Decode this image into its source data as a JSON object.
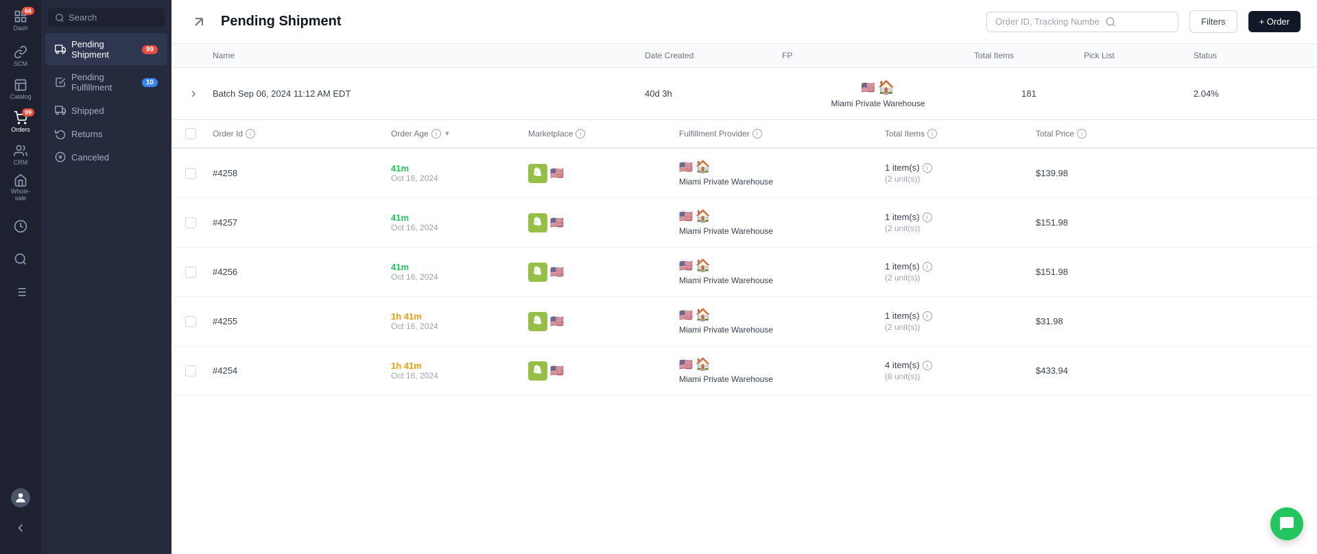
{
  "sidebar": {
    "notifications_badge": "66",
    "orders_badge": "99",
    "items": [
      {
        "id": "dash",
        "label": "Dash",
        "icon": "chart"
      },
      {
        "id": "scm",
        "label": "SCM",
        "icon": "link"
      },
      {
        "id": "catalog",
        "label": "Catalog",
        "icon": "catalog"
      },
      {
        "id": "orders",
        "label": "Orders",
        "icon": "cart",
        "badge": "99",
        "active": true
      },
      {
        "id": "crm",
        "label": "CRM",
        "icon": "users"
      },
      {
        "id": "wholesale",
        "label": "Whole-sale",
        "icon": "store"
      },
      {
        "id": "analytics",
        "label": "",
        "icon": "analytics"
      },
      {
        "id": "search",
        "label": "",
        "icon": "search"
      },
      {
        "id": "reports",
        "label": "",
        "icon": "reports"
      }
    ]
  },
  "nav": {
    "search_placeholder": "Search",
    "items": [
      {
        "id": "pending-shipment",
        "label": "Pending Shipment",
        "badge": "99",
        "badge_color": "red",
        "active": true
      },
      {
        "id": "pending-fulfillment",
        "label": "Pending Fulfillment",
        "badge": "10",
        "badge_color": "blue"
      },
      {
        "id": "shipped",
        "label": "Shipped",
        "badge": null
      },
      {
        "id": "returns",
        "label": "Returns",
        "badge": null
      },
      {
        "id": "canceled",
        "label": "Canceled",
        "badge": null
      }
    ]
  },
  "header": {
    "title": "Pending Shipment",
    "search_placeholder": "Order ID, Tracking Numbe",
    "filters_label": "Filters",
    "add_order_label": "+ Order"
  },
  "batch_table": {
    "columns": [
      "",
      "Name",
      "Date Created",
      "FP",
      "Total Items",
      "Pick List",
      "Status"
    ],
    "row": {
      "name": "Batch Sep 06, 2024 11:12 AM EDT",
      "age": "40d 3h",
      "fp_flag": "🇺🇸",
      "fp_warehouse": "🏠",
      "fp_name": "Miami Private Warehouse",
      "total_items": "181",
      "pick_list": "",
      "status": "2.04%"
    }
  },
  "orders_table": {
    "columns": {
      "order_id": "Order Id",
      "order_age": "Order Age",
      "marketplace": "Marketplace",
      "fulfillment_provider": "Fulfillment Provider",
      "total_items": "Total Items",
      "total_price": "Total Price"
    },
    "rows": [
      {
        "id": "#4258",
        "age": "41m",
        "age_color": "green",
        "date": "Oct 16, 2024",
        "marketplace": "shopify+flag",
        "fp_name": "Miami Private Warehouse",
        "items_count": "1 item(s)",
        "units": "(2 unit(s))",
        "price": "$139.98"
      },
      {
        "id": "#4257",
        "age": "41m",
        "age_color": "green",
        "date": "Oct 16, 2024",
        "marketplace": "shopify+flag",
        "fp_name": "Miami Private Warehouse",
        "items_count": "1 item(s)",
        "units": "(2 unit(s))",
        "price": "$151.98"
      },
      {
        "id": "#4256",
        "age": "41m",
        "age_color": "green",
        "date": "Oct 16, 2024",
        "marketplace": "shopify+flag",
        "fp_name": "Miami Private Warehouse",
        "items_count": "1 item(s)",
        "units": "(2 unit(s))",
        "price": "$151.98"
      },
      {
        "id": "#4255",
        "age": "1h 41m",
        "age_color": "orange",
        "date": "Oct 16, 2024",
        "marketplace": "shopify+flag",
        "fp_name": "Miami Private Warehouse",
        "items_count": "1 item(s)",
        "units": "(2 unit(s))",
        "price": "$31.98"
      },
      {
        "id": "#4254",
        "age": "1h 41m",
        "age_color": "orange",
        "date": "Oct 16, 2024",
        "marketplace": "shopify+flag",
        "fp_name": "Miami Private Warehouse",
        "items_count": "4 item(s)",
        "units": "(8 unit(s))",
        "price": "$433.94"
      }
    ]
  }
}
